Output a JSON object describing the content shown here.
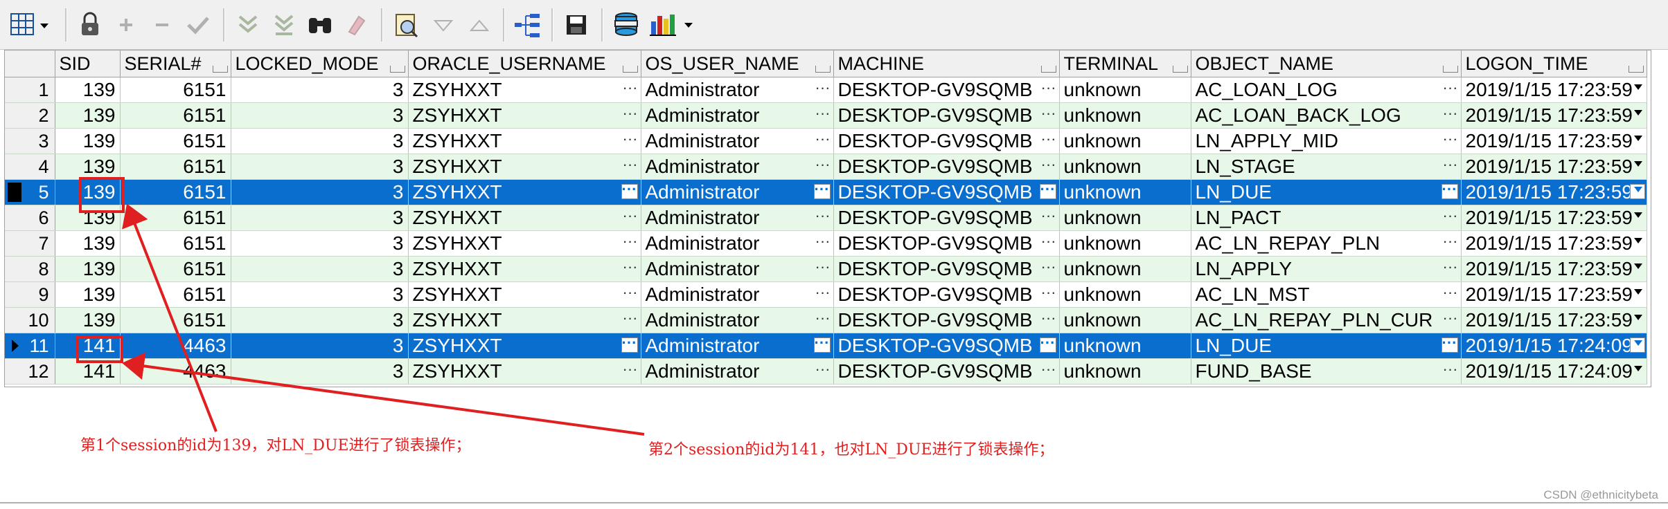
{
  "table": {
    "columns": [
      "SID",
      "SERIAL#",
      "LOCKED_MODE",
      "ORACLE_USERNAME",
      "OS_USER_NAME",
      "MACHINE",
      "TERMINAL",
      "OBJECT_NAME",
      "LOGON_TIME"
    ],
    "rows": [
      {
        "n": "1",
        "sid": "139",
        "serial": "6151",
        "mode": "3",
        "user": "ZSYHXXT",
        "os": "Administrator",
        "machine": "DESKTOP-GV9SQMB",
        "terminal": "unknown",
        "object": "AC_LOAN_LOG",
        "logon": "2019/1/15 17:23:59"
      },
      {
        "n": "2",
        "sid": "139",
        "serial": "6151",
        "mode": "3",
        "user": "ZSYHXXT",
        "os": "Administrator",
        "machine": "DESKTOP-GV9SQMB",
        "terminal": "unknown",
        "object": "AC_LOAN_BACK_LOG",
        "logon": "2019/1/15 17:23:59"
      },
      {
        "n": "3",
        "sid": "139",
        "serial": "6151",
        "mode": "3",
        "user": "ZSYHXXT",
        "os": "Administrator",
        "machine": "DESKTOP-GV9SQMB",
        "terminal": "unknown",
        "object": "LN_APPLY_MID",
        "logon": "2019/1/15 17:23:59"
      },
      {
        "n": "4",
        "sid": "139",
        "serial": "6151",
        "mode": "3",
        "user": "ZSYHXXT",
        "os": "Administrator",
        "machine": "DESKTOP-GV9SQMB",
        "terminal": "unknown",
        "object": "LN_STAGE",
        "logon": "2019/1/15 17:23:59"
      },
      {
        "n": "5",
        "sid": "139",
        "serial": "6151",
        "mode": "3",
        "user": "ZSYHXXT",
        "os": "Administrator",
        "machine": "DESKTOP-GV9SQMB",
        "terminal": "unknown",
        "object": "LN_DUE",
        "logon": "2019/1/15 17:23:59"
      },
      {
        "n": "6",
        "sid": "139",
        "serial": "6151",
        "mode": "3",
        "user": "ZSYHXXT",
        "os": "Administrator",
        "machine": "DESKTOP-GV9SQMB",
        "terminal": "unknown",
        "object": "LN_PACT",
        "logon": "2019/1/15 17:23:59"
      },
      {
        "n": "7",
        "sid": "139",
        "serial": "6151",
        "mode": "3",
        "user": "ZSYHXXT",
        "os": "Administrator",
        "machine": "DESKTOP-GV9SQMB",
        "terminal": "unknown",
        "object": "AC_LN_REPAY_PLN",
        "logon": "2019/1/15 17:23:59"
      },
      {
        "n": "8",
        "sid": "139",
        "serial": "6151",
        "mode": "3",
        "user": "ZSYHXXT",
        "os": "Administrator",
        "machine": "DESKTOP-GV9SQMB",
        "terminal": "unknown",
        "object": "LN_APPLY",
        "logon": "2019/1/15 17:23:59"
      },
      {
        "n": "9",
        "sid": "139",
        "serial": "6151",
        "mode": "3",
        "user": "ZSYHXXT",
        "os": "Administrator",
        "machine": "DESKTOP-GV9SQMB",
        "terminal": "unknown",
        "object": "AC_LN_MST",
        "logon": "2019/1/15 17:23:59"
      },
      {
        "n": "10",
        "sid": "139",
        "serial": "6151",
        "mode": "3",
        "user": "ZSYHXXT",
        "os": "Administrator",
        "machine": "DESKTOP-GV9SQMB",
        "terminal": "unknown",
        "object": "AC_LN_REPAY_PLN_CUR",
        "logon": "2019/1/15 17:23:59"
      },
      {
        "n": "11",
        "sid": "141",
        "serial": "4463",
        "mode": "3",
        "user": "ZSYHXXT",
        "os": "Administrator",
        "machine": "DESKTOP-GV9SQMB",
        "terminal": "unknown",
        "object": "LN_DUE",
        "logon": "2019/1/15 17:24:09"
      },
      {
        "n": "12",
        "sid": "141",
        "serial": "4463",
        "mode": "3",
        "user": "ZSYHXXT",
        "os": "Administrator",
        "machine": "DESKTOP-GV9SQMB",
        "terminal": "unknown",
        "object": "FUND_BASE",
        "logon": "2019/1/15 17:24:09"
      }
    ],
    "selected_rows": [
      "5",
      "11"
    ],
    "current_row": "11"
  },
  "annotations": {
    "note1": "第1个session的id为139，对LN_DUE进行了锁表操作；",
    "note2": "第2个session的id为141，也对LN_DUE进行了锁表操作；",
    "color": "#e02020"
  },
  "toolbar": {
    "icons": [
      "grid-options-icon",
      "lock-icon",
      "add-record-icon",
      "delete-record-icon",
      "post-changes-icon",
      "next-record-icon",
      "last-record-icon",
      "find-binoculars-icon",
      "clear-icon",
      "query-by-example-icon",
      "sort-ascending-icon",
      "sort-descending-icon",
      "explain-plan-icon",
      "save-icon",
      "export-database-icon",
      "chart-icon"
    ]
  },
  "watermark": "CSDN @ethnicitybeta",
  "colors": {
    "selection": "#0a6ecf",
    "even_row": "#e8f8e8",
    "header": "#f0f0f0"
  }
}
